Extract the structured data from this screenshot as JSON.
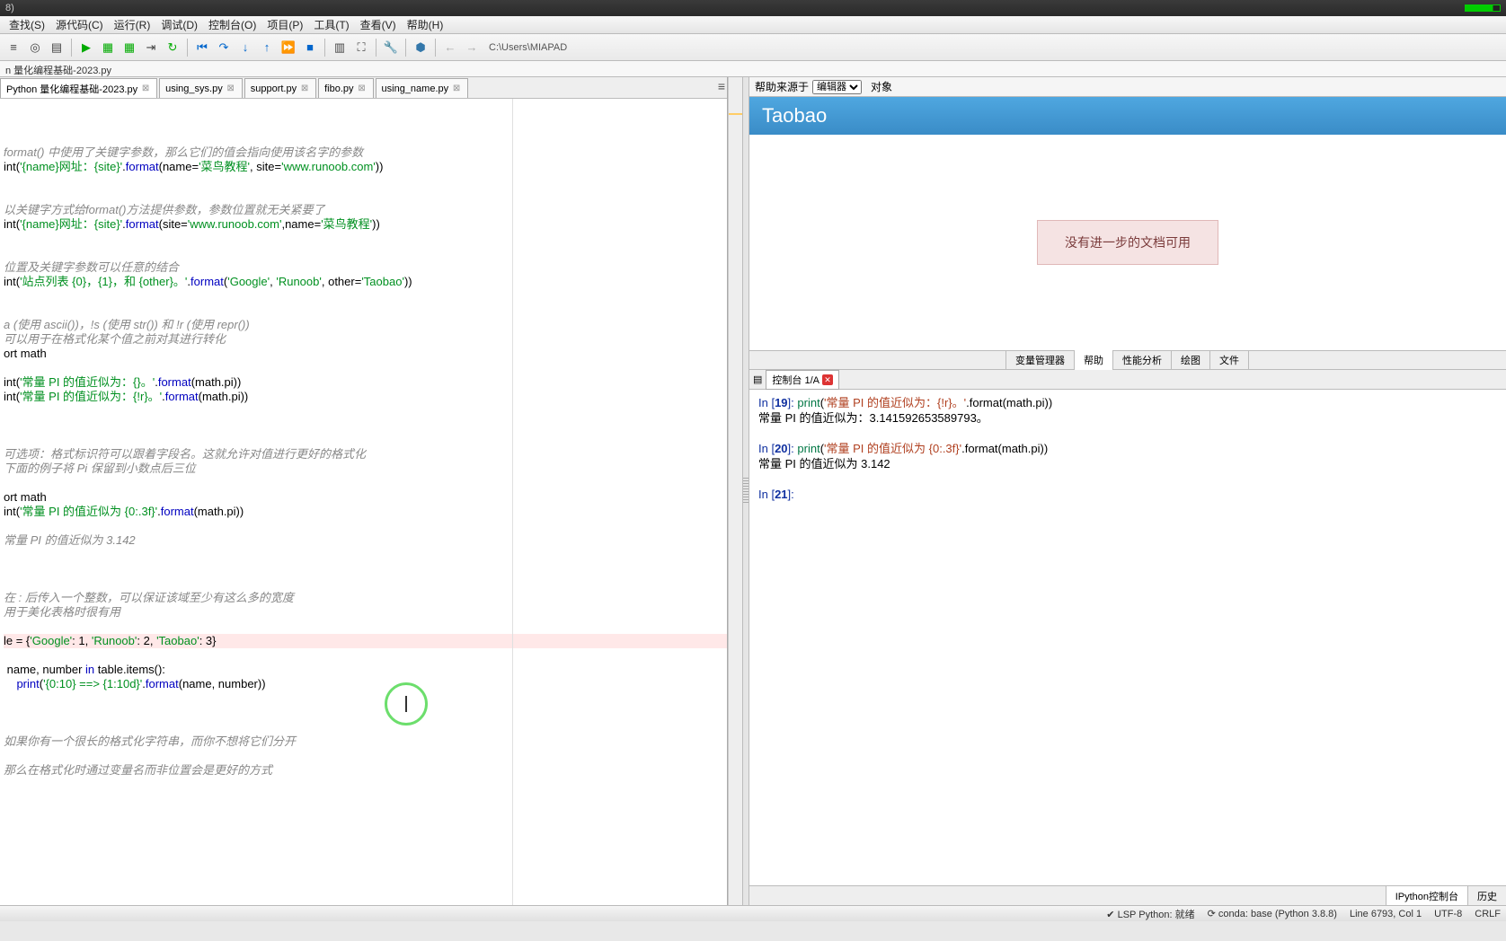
{
  "titlebar": {
    "left": "8)"
  },
  "menubar": {
    "items": [
      "查找(S)",
      "源代码(C)",
      "运行(R)",
      "调试(D)",
      "控制台(O)",
      "项目(P)",
      "工具(T)",
      "查看(V)",
      "帮助(H)"
    ]
  },
  "toolbar": {
    "path": "C:\\Users\\MIAPAD"
  },
  "filetab": "n  量化编程基础-2023.py",
  "editorTabs": [
    {
      "label": "Python 量化编程基础-2023.py",
      "active": true
    },
    {
      "label": "using_sys.py",
      "active": false
    },
    {
      "label": "support.py",
      "active": false
    },
    {
      "label": "fibo.py",
      "active": false
    },
    {
      "label": "using_name.py",
      "active": false
    }
  ],
  "code": [
    {
      "t": "cmt",
      "s": "format() 中使用了关键字参数，那么它们的值会指向使用该名字的参数"
    },
    {
      "t": "code",
      "s": "int('{name}网址：{site}'.format(name='菜鸟教程', site='www.runoob.com'))"
    },
    {
      "t": "blank",
      "s": ""
    },
    {
      "t": "blank",
      "s": ""
    },
    {
      "t": "cmt",
      "s": "以关键字方式给format()方法提供参数，参数位置就无关紧要了"
    },
    {
      "t": "code",
      "s": "int('{name}网址：{site}'.format(site='www.runoob.com',name='菜鸟教程'))"
    },
    {
      "t": "blank",
      "s": ""
    },
    {
      "t": "blank",
      "s": ""
    },
    {
      "t": "cmt",
      "s": "位置及关键字参数可以任意的结合"
    },
    {
      "t": "code",
      "s": "int('站点列表 {0}，{1}，和 {other}。'.format('Google', 'Runoob', other='Taobao'))"
    },
    {
      "t": "blank",
      "s": ""
    },
    {
      "t": "blank",
      "s": ""
    },
    {
      "t": "cmt",
      "s": "a (使用 ascii())，!s (使用 str()) 和 !r (使用 repr())"
    },
    {
      "t": "cmt",
      "s": "可以用于在格式化某个值之前对其进行转化"
    },
    {
      "t": "code",
      "s": "ort math"
    },
    {
      "t": "blank",
      "s": ""
    },
    {
      "t": "code",
      "s": "int('常量 PI 的值近似为：{}。'.format(math.pi))"
    },
    {
      "t": "code",
      "s": "int('常量 PI 的值近似为：{!r}。'.format(math.pi))"
    },
    {
      "t": "blank",
      "s": ""
    },
    {
      "t": "blank",
      "s": ""
    },
    {
      "t": "blank",
      "s": ""
    },
    {
      "t": "cmt",
      "s": "可选项：格式标识符可以跟着字段名。这就允许对值进行更好的格式化"
    },
    {
      "t": "cmt",
      "s": "下面的例子将 Pi 保留到小数点后三位"
    },
    {
      "t": "blank",
      "s": ""
    },
    {
      "t": "code",
      "s": "ort math"
    },
    {
      "t": "code",
      "s": "int('常量 PI 的值近似为 {0:.3f}'.format(math.pi))"
    },
    {
      "t": "blank",
      "s": ""
    },
    {
      "t": "cmt",
      "s": "常量 PI 的值近似为 3.142"
    },
    {
      "t": "blank",
      "s": ""
    },
    {
      "t": "blank",
      "s": ""
    },
    {
      "t": "blank",
      "s": ""
    },
    {
      "t": "cmt",
      "s": "在 : 后传入一个整数，可以保证该域至少有这么多的宽度"
    },
    {
      "t": "cmt",
      "s": "用于美化表格时很有用"
    },
    {
      "t": "blank",
      "s": ""
    },
    {
      "t": "hl",
      "s": "le = {'Google': 1, 'Runoob': 2, 'Taobao': 3}"
    },
    {
      "t": "blank",
      "s": ""
    },
    {
      "t": "code",
      "s": " name, number in table.items():"
    },
    {
      "t": "code",
      "s": "    print('{0:10} ==> {1:10d}'.format(name, number))"
    },
    {
      "t": "blank",
      "s": ""
    },
    {
      "t": "blank",
      "s": ""
    },
    {
      "t": "blank",
      "s": ""
    },
    {
      "t": "cmt",
      "s": "如果你有一个很长的格式化字符串，而你不想将它们分开"
    },
    {
      "t": "blank",
      "s": ""
    },
    {
      "t": "cmt",
      "s": "那么在格式化时通过变量名而非位置会是更好的方式"
    }
  ],
  "help": {
    "sourceLabel": "帮助来源于",
    "sourceSel": "编辑器",
    "obj": "对象",
    "title": "Taobao",
    "noDoc": "没有进一步的文档可用"
  },
  "rightTabs": [
    "变量管理器",
    "帮助",
    "性能分析",
    "绘图",
    "文件"
  ],
  "rightTabActive": 1,
  "consoleTab": "控制台 1/A",
  "consoleLines": [
    {
      "type": "in",
      "n": "19",
      "code": "print('常量 PI 的值近似为：{!r}。'.format(math.pi))"
    },
    {
      "type": "out",
      "s": "常量 PI 的值近似为：3.141592653589793。"
    },
    {
      "type": "blank"
    },
    {
      "type": "in",
      "n": "20",
      "code": "print('常量 PI 的值近似为 {0:.3f}'.format(math.pi))"
    },
    {
      "type": "out",
      "s": "常量 PI 的值近似为 3.142"
    },
    {
      "type": "blank"
    },
    {
      "type": "prompt",
      "n": "21"
    }
  ],
  "bottomTabs": [
    "IPython控制台",
    "历史"
  ],
  "bottomTabActive": 0,
  "status": {
    "lsp": "LSP Python: 就绪",
    "conda": "conda: base (Python 3.8.8)",
    "pos": "Line 6793, Col 1",
    "enc": "UTF-8",
    "eol": "CRLF"
  }
}
